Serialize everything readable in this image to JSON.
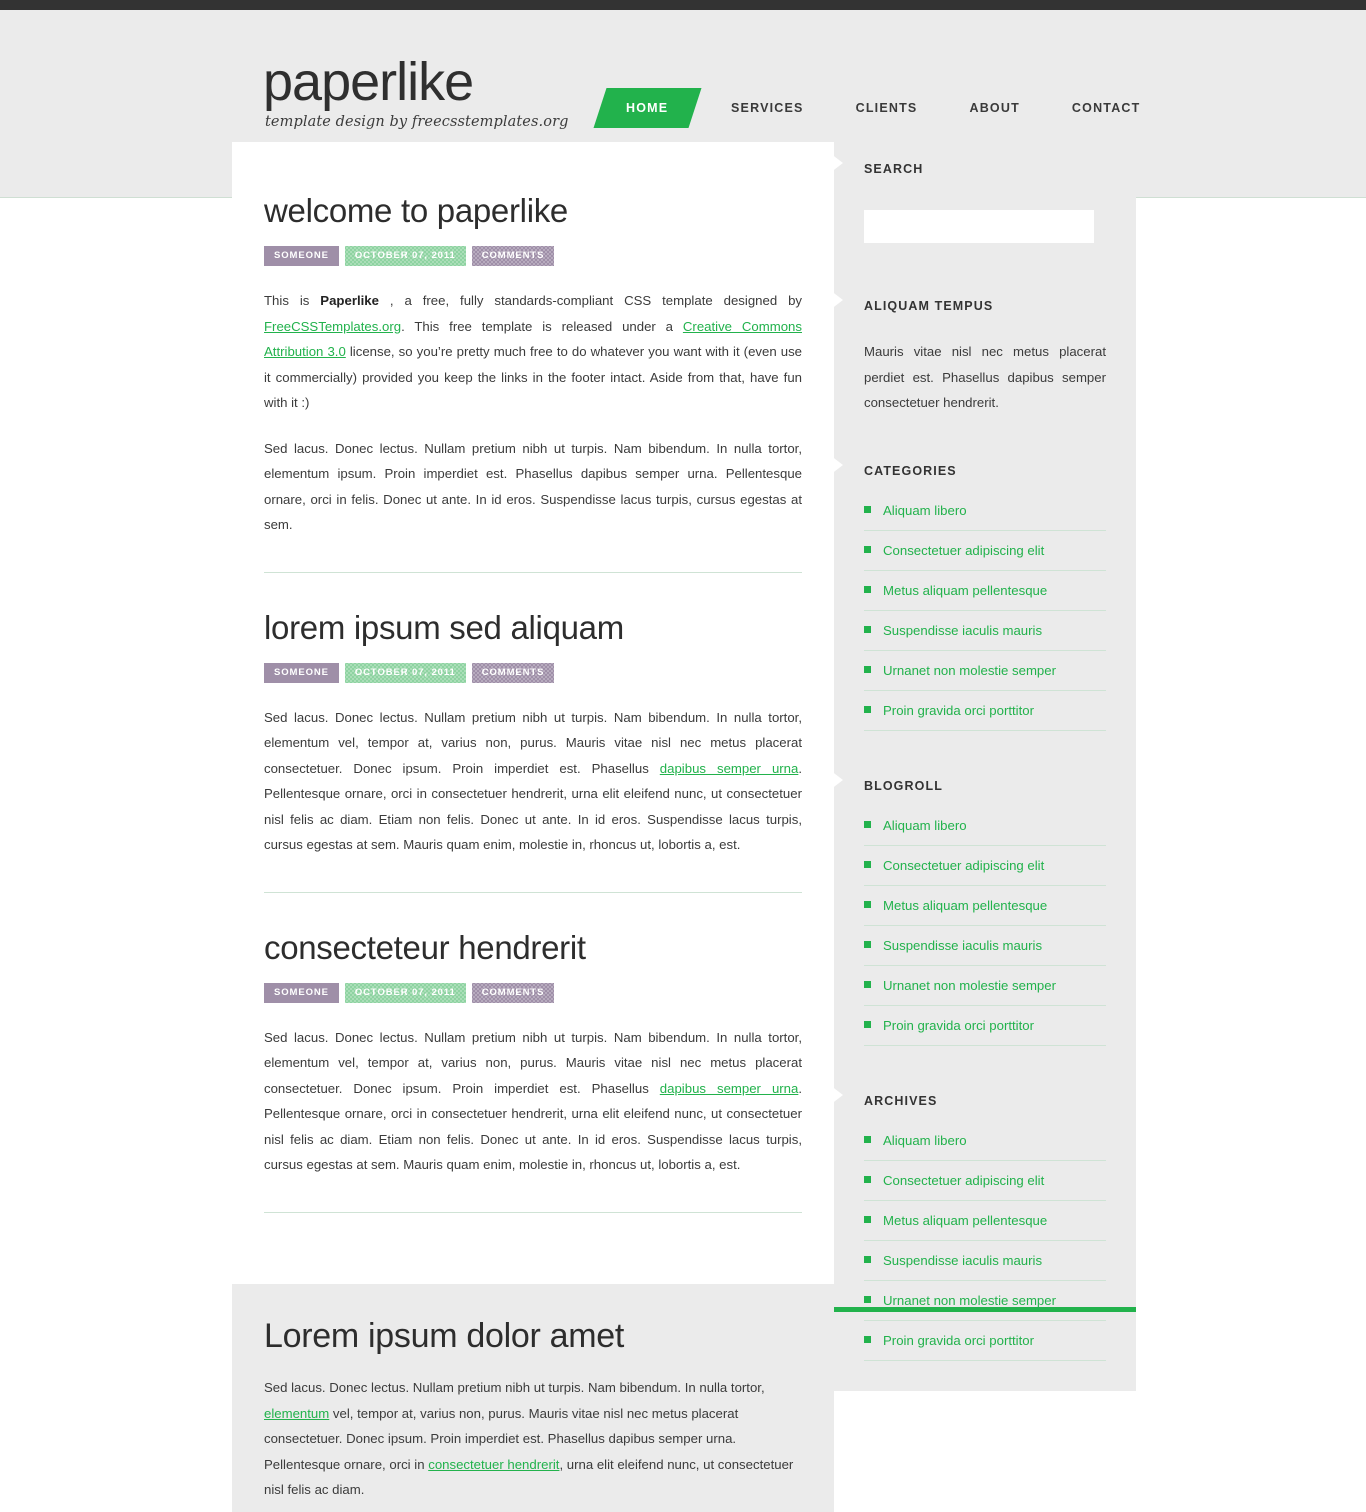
{
  "site": {
    "logo_title": "paperlike",
    "logo_tagline": "template design by freecsstemplates.org",
    "accent_color": "#22b24c",
    "header_bg": "#ebebeb",
    "topbar_color": "#333333"
  },
  "nav": {
    "items": [
      {
        "label": "HOME",
        "active": true
      },
      {
        "label": "SERVICES",
        "active": false
      },
      {
        "label": "CLIENTS",
        "active": false
      },
      {
        "label": "ABOUT",
        "active": false
      },
      {
        "label": "CONTACT",
        "active": false
      }
    ]
  },
  "posts": [
    {
      "title": "welcome to paperlike",
      "meta": {
        "author": "SOMEONE",
        "date": "OCTOBER 07, 2011",
        "comments": "COMMENTS"
      },
      "paragraphs": [
        {
          "segments": [
            {
              "type": "text",
              "text": "This is "
            },
            {
              "type": "bold",
              "text": "Paperlike"
            },
            {
              "type": "text",
              "text": " , a free, fully standards-compliant CSS template designed by "
            },
            {
              "type": "link",
              "text": "FreeCSSTemplates.org"
            },
            {
              "type": "text",
              "text": ". This free template is released under a "
            },
            {
              "type": "link",
              "text": "Creative Commons Attribution 3.0"
            },
            {
              "type": "text",
              "text": " license, so you’re pretty much free to do whatever you want with it (even use it commercially) provided you keep the links in the footer intact. Aside from that, have fun with it :)"
            }
          ]
        },
        {
          "segments": [
            {
              "type": "text",
              "text": "Sed lacus. Donec lectus. Nullam pretium nibh ut turpis. Nam bibendum. In nulla tortor, elementum ipsum. Proin imperdiet est. Phasellus dapibus semper urna. Pellentesque ornare, orci in felis. Donec ut ante. In id eros. Suspendisse lacus turpis, cursus egestas at sem."
            }
          ]
        }
      ]
    },
    {
      "title": "lorem ipsum sed aliquam",
      "meta": {
        "author": "SOMEONE",
        "date": "OCTOBER 07, 2011",
        "comments": "COMMENTS"
      },
      "paragraphs": [
        {
          "segments": [
            {
              "type": "text",
              "text": "Sed lacus. Donec lectus. Nullam pretium nibh ut turpis. Nam bibendum. In nulla tortor, elementum vel, tempor at, varius non, purus. Mauris vitae nisl nec metus placerat consectetuer. Donec ipsum. Proin imperdiet est. Phasellus "
            },
            {
              "type": "link",
              "text": "dapibus semper urna"
            },
            {
              "type": "text",
              "text": ". Pellentesque ornare, orci in consectetuer hendrerit, urna elit eleifend nunc, ut consectetuer nisl felis ac diam. Etiam non felis. Donec ut ante. In id eros. Suspendisse lacus turpis, cursus egestas at sem. Mauris quam enim, molestie in, rhoncus ut, lobortis a, est."
            }
          ]
        }
      ]
    },
    {
      "title": "consecteteur hendrerit",
      "meta": {
        "author": "SOMEONE",
        "date": "OCTOBER 07, 2011",
        "comments": "COMMENTS"
      },
      "paragraphs": [
        {
          "segments": [
            {
              "type": "text",
              "text": "Sed lacus. Donec lectus. Nullam pretium nibh ut turpis. Nam bibendum. In nulla tortor, elementum vel, tempor at, varius non, purus. Mauris vitae nisl nec metus placerat consectetuer. Donec ipsum. Proin imperdiet est. Phasellus "
            },
            {
              "type": "link",
              "text": "dapibus semper urna"
            },
            {
              "type": "text",
              "text": ". Pellentesque ornare, orci in consectetuer hendrerit, urna elit eleifend nunc, ut consectetuer nisl felis ac diam. Etiam non felis. Donec ut ante. In id eros. Suspendisse lacus turpis, cursus egestas at sem. Mauris quam enim, molestie in, rhoncus ut, lobortis a, est."
            }
          ]
        }
      ]
    }
  ],
  "sidebar": {
    "search": {
      "title": "SEARCH",
      "value": "",
      "placeholder": ""
    },
    "about": {
      "title": "ALIQUAM TEMPUS",
      "text": "Mauris vitae nisl nec metus placerat perdiet est. Phasellus dapibus semper consectetuer hendrerit."
    },
    "widgets": [
      {
        "title": "CATEGORIES",
        "items": [
          "Aliquam libero",
          "Consectetuer adipiscing elit",
          "Metus aliquam pellentesque",
          "Suspendisse iaculis mauris",
          "Urnanet non molestie semper",
          "Proin gravida orci porttitor"
        ]
      },
      {
        "title": "BLOGROLL",
        "items": [
          "Aliquam libero",
          "Consectetuer adipiscing elit",
          "Metus aliquam pellentesque",
          "Suspendisse iaculis mauris",
          "Urnanet non molestie semper",
          "Proin gravida orci porttitor"
        ]
      },
      {
        "title": "ARCHIVES",
        "items": [
          "Aliquam libero",
          "Consectetuer adipiscing elit",
          "Metus aliquam pellentesque",
          "Suspendisse iaculis mauris",
          "Urnanet non molestie semper",
          "Proin gravida orci porttitor"
        ]
      }
    ]
  },
  "footer_feature": {
    "title": "Lorem ipsum dolor amet",
    "segments": [
      {
        "type": "text",
        "text": "Sed lacus. Donec lectus. Nullam pretium nibh ut turpis. Nam bibendum. In nulla tortor, "
      },
      {
        "type": "link",
        "text": "elementum"
      },
      {
        "type": "text",
        "text": " vel, tempor at, varius non, purus. Mauris vitae nisl nec metus placerat consectetuer. Donec ipsum. Proin imperdiet est. Phasellus dapibus semper urna. Pellentesque ornare, orci in "
      },
      {
        "type": "link",
        "text": "consectetuer hendrerit"
      },
      {
        "type": "text",
        "text": ", urna elit eleifend nunc, ut consectetuer nisl felis ac diam."
      }
    ]
  }
}
